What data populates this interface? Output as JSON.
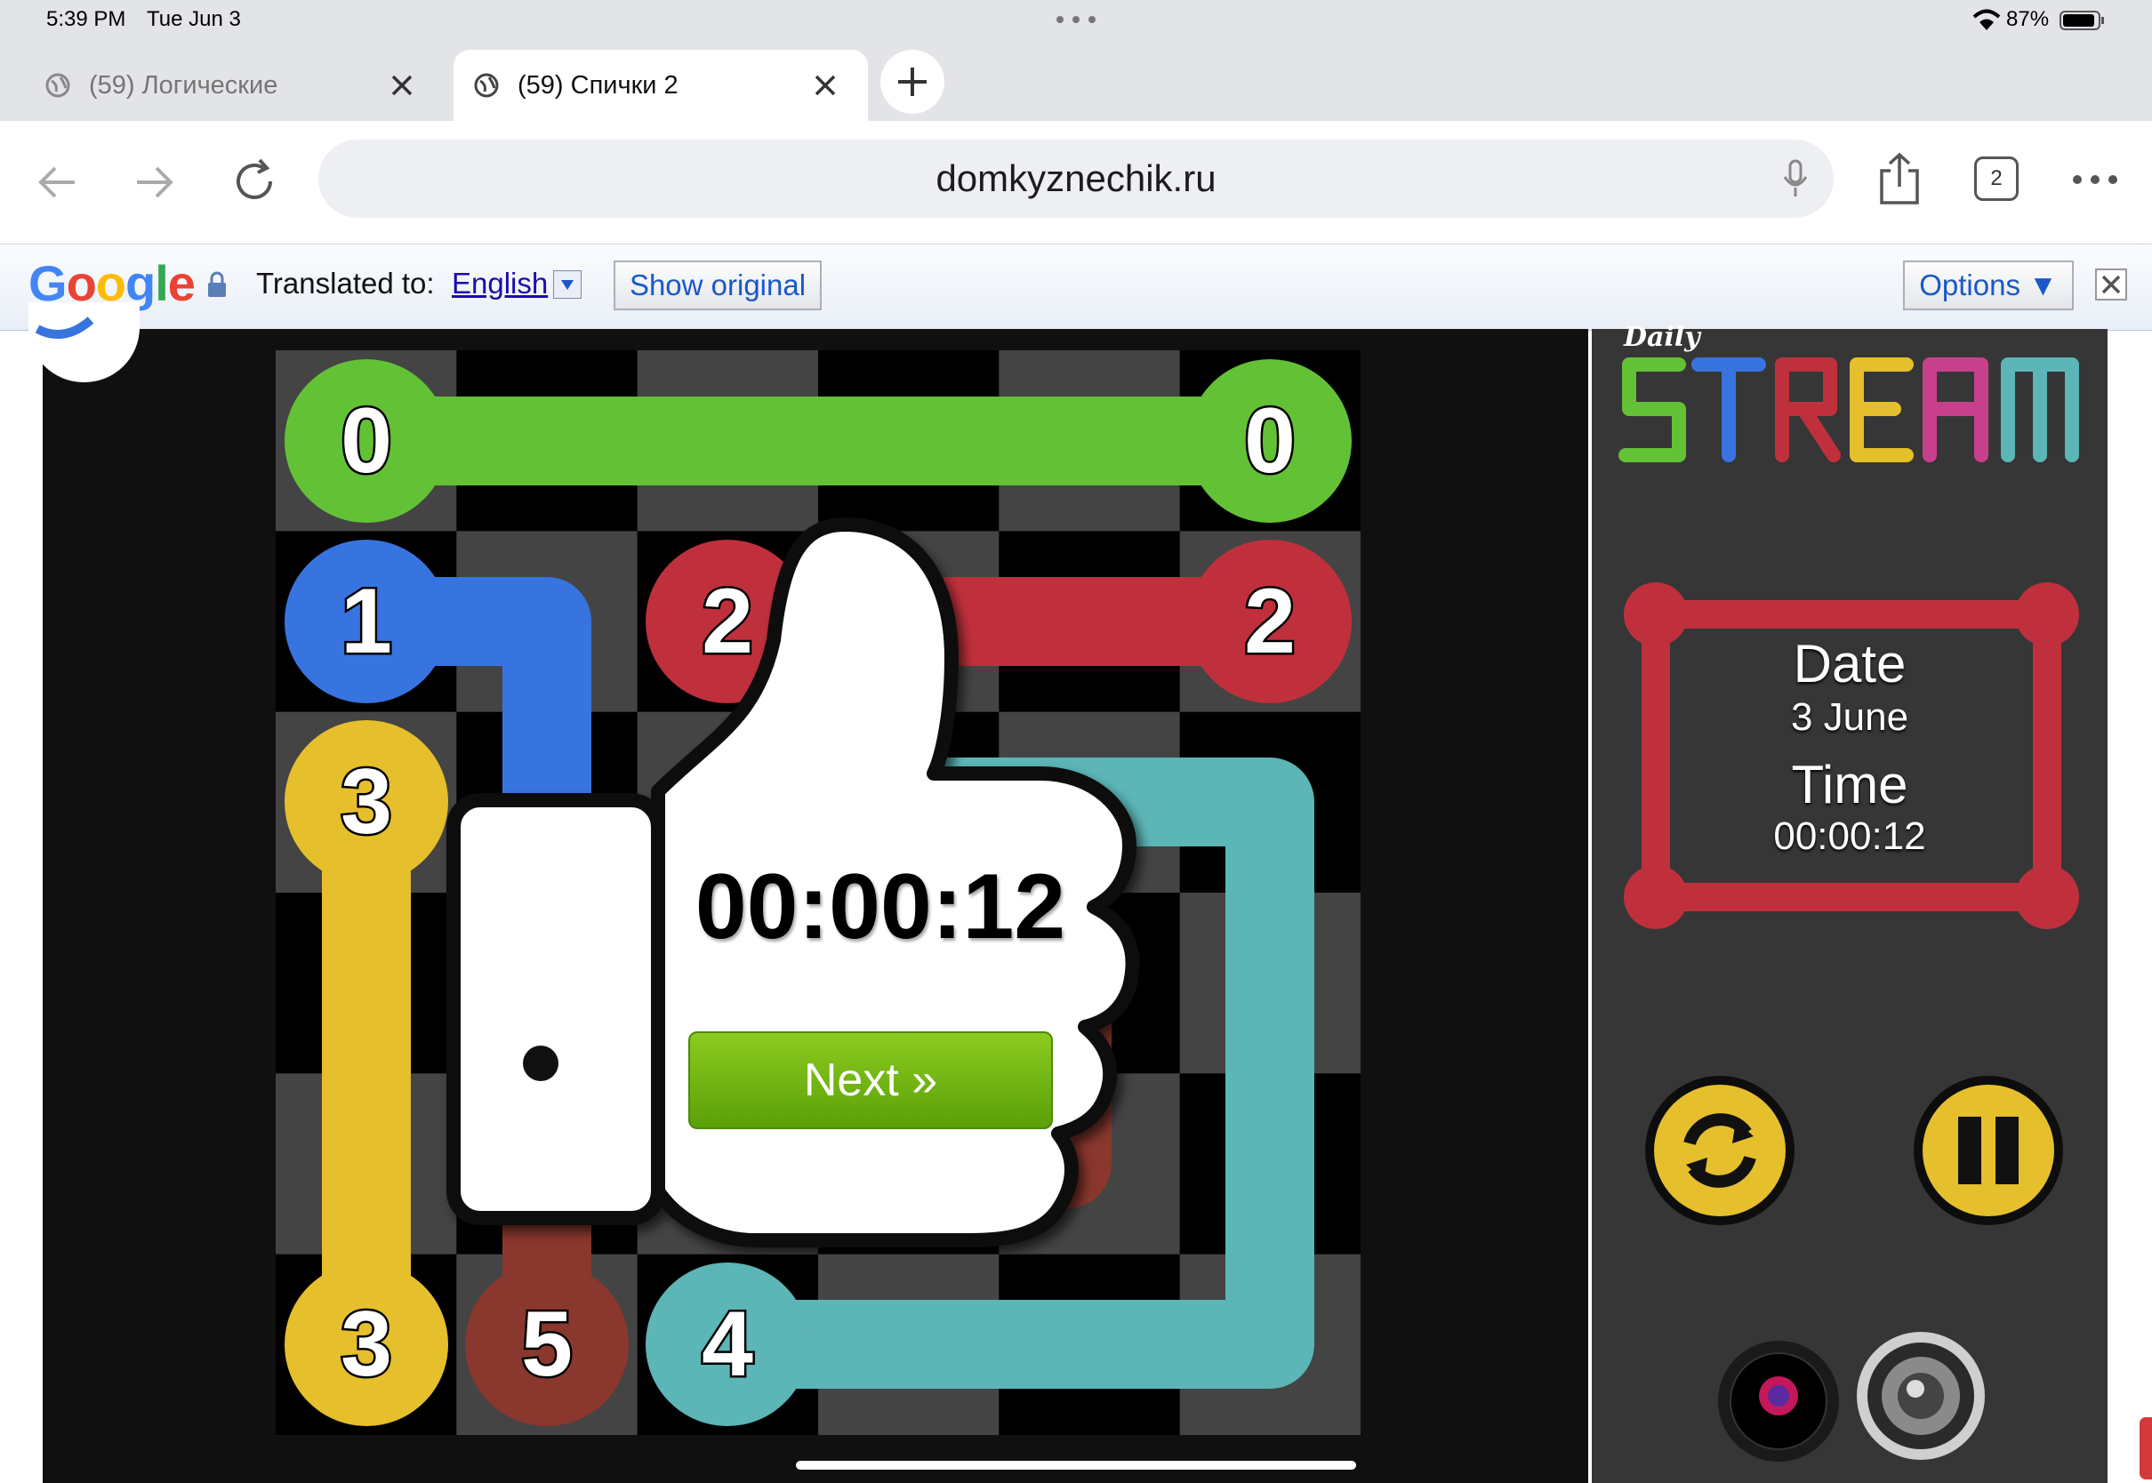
{
  "status_bar": {
    "time": "5:39 PM",
    "date": "Tue Jun 3",
    "battery": "87%"
  },
  "tabs": [
    {
      "title": "(59) Логические",
      "active": false
    },
    {
      "title": "(59) Спички 2",
      "active": true
    }
  ],
  "toolbar": {
    "url": "domkyznechik.ru",
    "tab_count": "2"
  },
  "translate_bar": {
    "logo": "Google",
    "translated_to_label": "Translated to:",
    "language": "English",
    "show_original": "Show original",
    "options": "Options ▼"
  },
  "game": {
    "logo_small": "Daily",
    "logo_big": "STREAM",
    "date_label": "Date",
    "date_value": "3 June",
    "time_label": "Time",
    "time_value": "00:00:12",
    "overlay_timer": "00:00:12",
    "next_button": "Next »",
    "endpoints": [
      "0",
      "0",
      "1",
      "2",
      "2",
      "3",
      "3",
      "5",
      "4"
    ]
  },
  "colors": {
    "green": "#63c136",
    "blue": "#3874e0",
    "red": "#c0303c",
    "yellow": "#e6bf2c",
    "teal": "#5cb5b6",
    "brown": "#8a372d"
  }
}
